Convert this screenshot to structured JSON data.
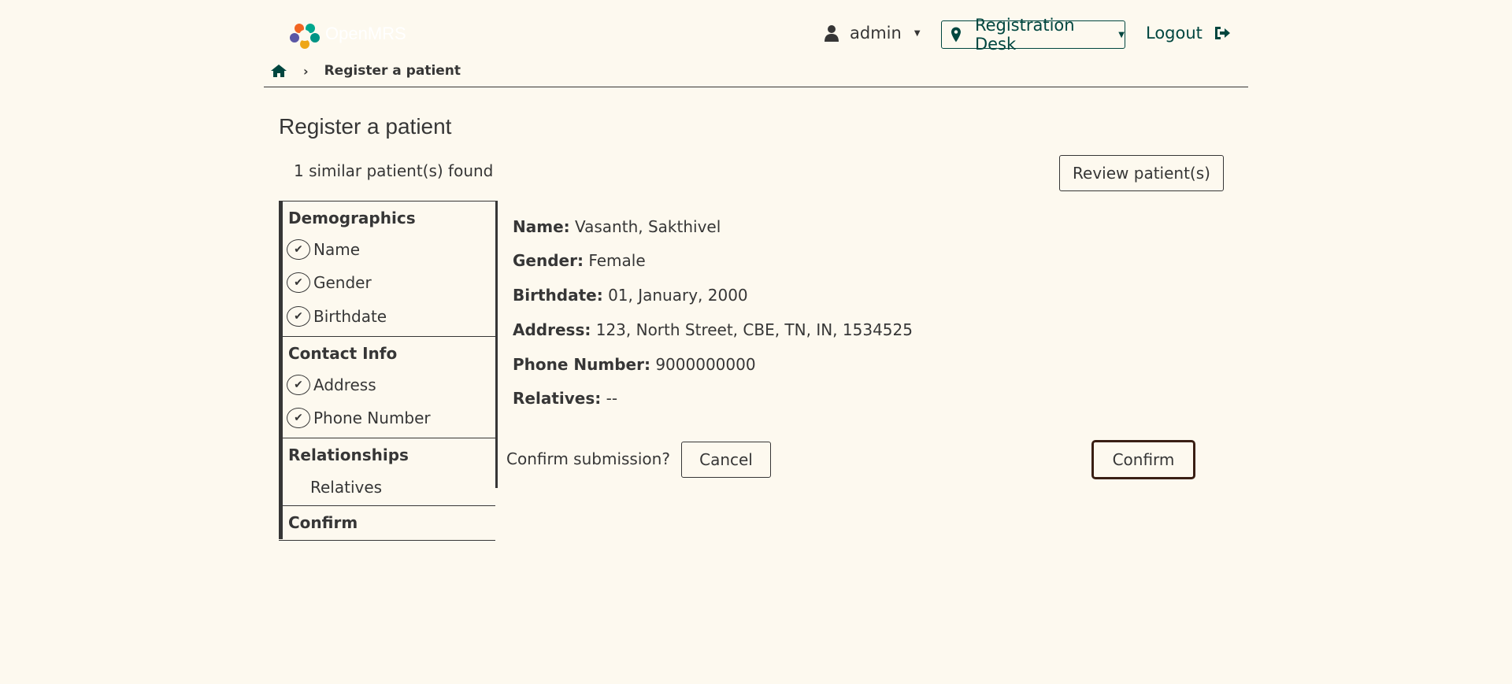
{
  "header": {
    "logo_text": "OpenMRS",
    "user": {
      "name": "admin",
      "icon": "user-icon"
    },
    "location": {
      "label": "Registration Desk",
      "icon": "map-marker-icon"
    },
    "logout": {
      "label": "Logout",
      "icon": "sign-out-icon"
    }
  },
  "breadcrumb": {
    "home_icon": "home-icon",
    "current": "Register a patient"
  },
  "page": {
    "title": "Register a patient",
    "similar_found": "1 similar patient(s) found",
    "review_button": "Review patient(s)"
  },
  "sidebar": {
    "sections": [
      {
        "title": "Demographics",
        "steps": [
          "Name",
          "Gender",
          "Birthdate"
        ]
      },
      {
        "title": "Contact Info",
        "steps": [
          "Address",
          "Phone Number"
        ]
      },
      {
        "title": "Relationships",
        "steps": [
          "Relatives"
        ]
      },
      {
        "title": "Confirm",
        "steps": []
      }
    ]
  },
  "details": {
    "name": {
      "label": "Name:",
      "value": "Vasanth, Sakthivel"
    },
    "gender": {
      "label": "Gender:",
      "value": "Female"
    },
    "birthdate": {
      "label": "Birthdate:",
      "value": "01, January, 2000"
    },
    "address": {
      "label": "Address:",
      "value": "123, North Street, CBE, TN, IN, 1534525"
    },
    "phone": {
      "label": "Phone Number:",
      "value": "9000000000"
    },
    "relatives": {
      "label": "Relatives:",
      "value": "--"
    }
  },
  "confirmation": {
    "question": "Confirm submission?",
    "cancel_label": "Cancel",
    "confirm_label": "Confirm"
  }
}
